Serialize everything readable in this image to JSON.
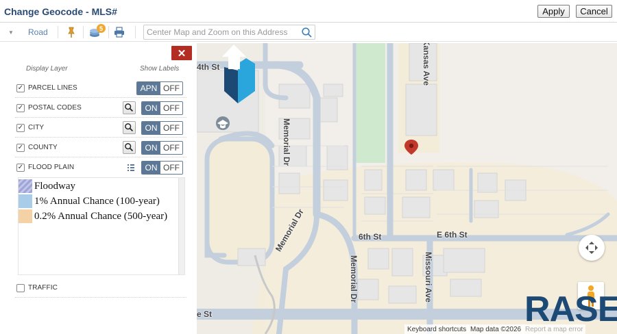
{
  "header": {
    "title": "Change Geocode - MLS#",
    "apply_label": "Apply",
    "cancel_label": "Cancel"
  },
  "toolbar": {
    "map_type": "Road",
    "layers_badge": "5",
    "search_placeholder": "Center Map and Zoom on this Address"
  },
  "panel": {
    "display_layer_heading": "Display Layer",
    "show_labels_heading": "Show Labels",
    "layers": [
      {
        "label": "PARCEL LINES",
        "checked": true,
        "toggle_on": "APN",
        "toggle_off": "OFF"
      },
      {
        "label": "POSTAL CODES",
        "checked": true,
        "toggle_on": "ON",
        "toggle_off": "OFF"
      },
      {
        "label": "CITY",
        "checked": true,
        "toggle_on": "ON",
        "toggle_off": "OFF"
      },
      {
        "label": "COUNTY",
        "checked": true,
        "toggle_on": "ON",
        "toggle_off": "OFF"
      },
      {
        "label": "FLOOD PLAIN",
        "checked": true,
        "toggle_on": "ON",
        "toggle_off": "OFF"
      },
      {
        "label": "TRAFFIC",
        "checked": false
      }
    ],
    "flood_legend": [
      {
        "label": "Floodway",
        "color": "#9fa6d6"
      },
      {
        "label": "1% Annual Chance (100-year)",
        "color": "#a9cde8"
      },
      {
        "label": "0.2% Annual Chance (500-year)",
        "color": "#f5d2a6"
      }
    ]
  },
  "map": {
    "streets": {
      "fourth": "4th St",
      "memorial_dr": "Memorial Dr",
      "kansas_ave": "Kansas Ave",
      "memorial_dr_2": "Memorial Dr",
      "memorial_dr_3": "Memorial Dr",
      "sixth": "6th St",
      "e_sixth": "E 6th St",
      "missouri_ave": "Missouri Ave",
      "bottom_st": "e St"
    },
    "attribution": {
      "shortcuts": "Keyboard shortcuts",
      "data": "Map data ©2026",
      "terms": "Report a map error"
    },
    "logo_text": "RASE",
    "colors": {
      "park": "#c8e6c9",
      "school": "#f3ecd8",
      "road": "#c3cfdd",
      "building": "#e9e9e9",
      "pin": "#c0392b"
    }
  }
}
